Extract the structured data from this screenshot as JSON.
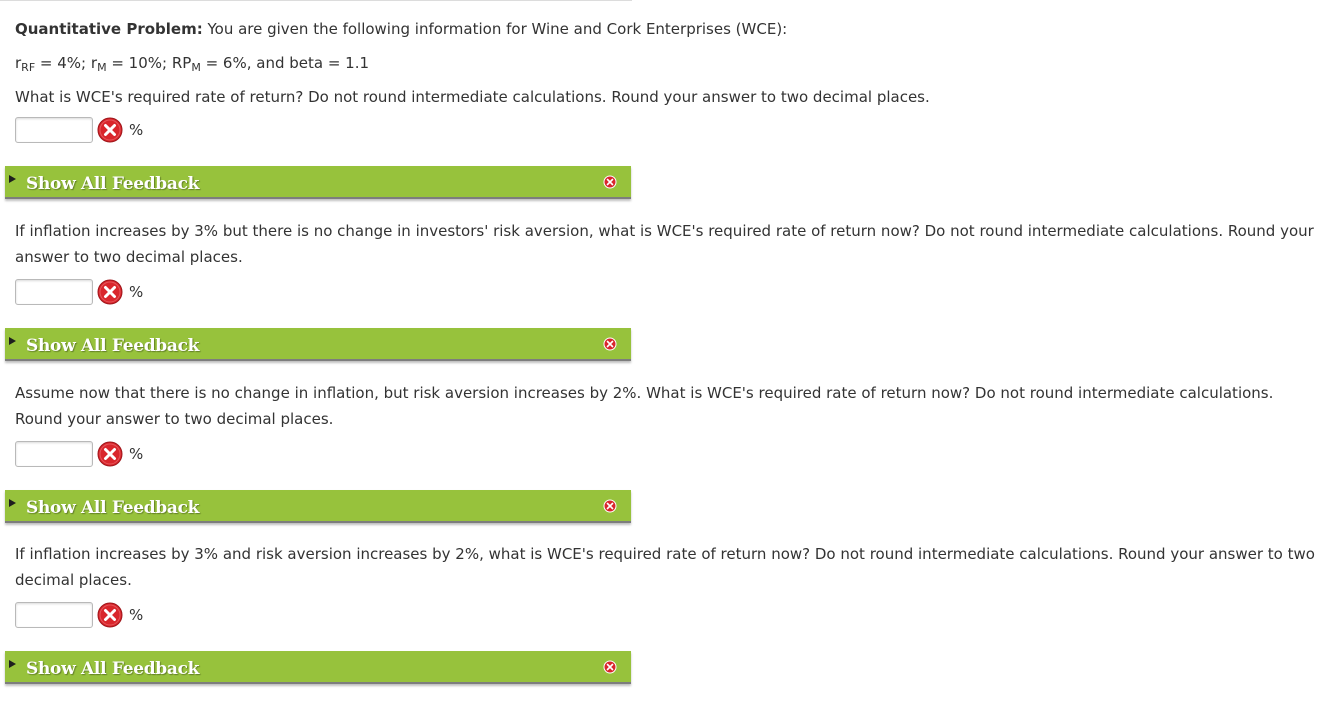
{
  "intro": {
    "label": "Quantitative Problem:",
    "text": " You are given the following information for Wine and Cork Enterprises (WCE):",
    "givens": {
      "rrf_sym": "r",
      "rrf_sub": "RF",
      "rrf_val": " = 4%; ",
      "rm_sym": "r",
      "rm_sub": "M",
      "rm_val": " = 10%; ",
      "rpm_sym": "RP",
      "rpm_sub": "M",
      "rpm_val": " = 6%, and beta = 1.1"
    },
    "question": "What is WCE's required rate of return? Do not round intermediate calculations. Round your answer to two decimal places."
  },
  "answers": [
    {
      "value": "",
      "unit": "%"
    },
    {
      "value": "",
      "unit": "%"
    },
    {
      "value": "",
      "unit": "%"
    },
    {
      "value": "",
      "unit": "%"
    }
  ],
  "feedback_label": "Show All Feedback",
  "questions": [
    "If inflation increases by 3% but there is no change in investors' risk aversion, what is WCE's required rate of return now? Do not round intermediate calculations. Round your answer to two decimal places.",
    "Assume now that there is no change in inflation, but risk aversion increases by 2%. What is WCE's required rate of return now? Do not round intermediate calculations. Round your answer to two decimal places.",
    "If inflation increases by 3% and risk aversion increases by 2%, what is WCE's required rate of return now? Do not round intermediate calculations. Round your answer to two decimal places."
  ],
  "colors": {
    "feedback_bar": "#97c23c",
    "incorrect_icon": "#d9262c"
  },
  "icons": {
    "incorrect": "x-circle-icon",
    "expand": "triangle-right-icon",
    "close": "close-icon"
  }
}
